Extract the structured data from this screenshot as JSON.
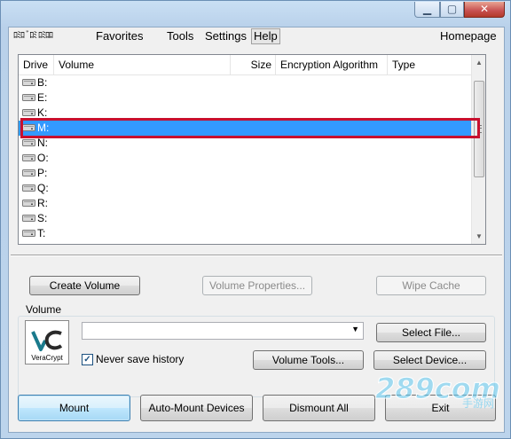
{
  "window": {
    "controls": {
      "minimize": "▁",
      "maximize": "▢",
      "close": "✕"
    }
  },
  "menu": {
    "items": [
      "Volumes",
      "System",
      "Favorites",
      "Tools",
      "Settings",
      "Help"
    ],
    "overlay_text": "ﾛﾐﾛ ﾞﾛﾐ ﾛﾐﾛﾛ",
    "right": "Homepage"
  },
  "list": {
    "columns": [
      "Drive",
      "Volume",
      "Size",
      "Encryption Algorithm",
      "Type"
    ],
    "drives": [
      "B:",
      "E:",
      "K:",
      "M:",
      "N:",
      "O:",
      "P:",
      "Q:",
      "R:",
      "S:",
      "T:"
    ],
    "selected": "M:"
  },
  "buttons": {
    "create_volume": "Create Volume",
    "volume_properties": "Volume Properties...",
    "wipe_cache": "Wipe Cache",
    "select_file": "Select File...",
    "volume_tools": "Volume Tools...",
    "select_device": "Select Device...",
    "mount": "Mount",
    "auto_mount": "Auto-Mount Devices",
    "dismount_all": "Dismount All",
    "exit": "Exit"
  },
  "volume": {
    "group_label": "Volume",
    "path_value": "",
    "never_save_history_label": "Never save history",
    "never_save_history_checked": true,
    "logo_text": "VeraCrypt"
  },
  "watermark": {
    "text": "289com",
    "subtext": "手游网"
  },
  "colors": {
    "selection": "#3399ff",
    "highlight_box": "#c8102e",
    "logo_teal": "#1a7a8c"
  }
}
